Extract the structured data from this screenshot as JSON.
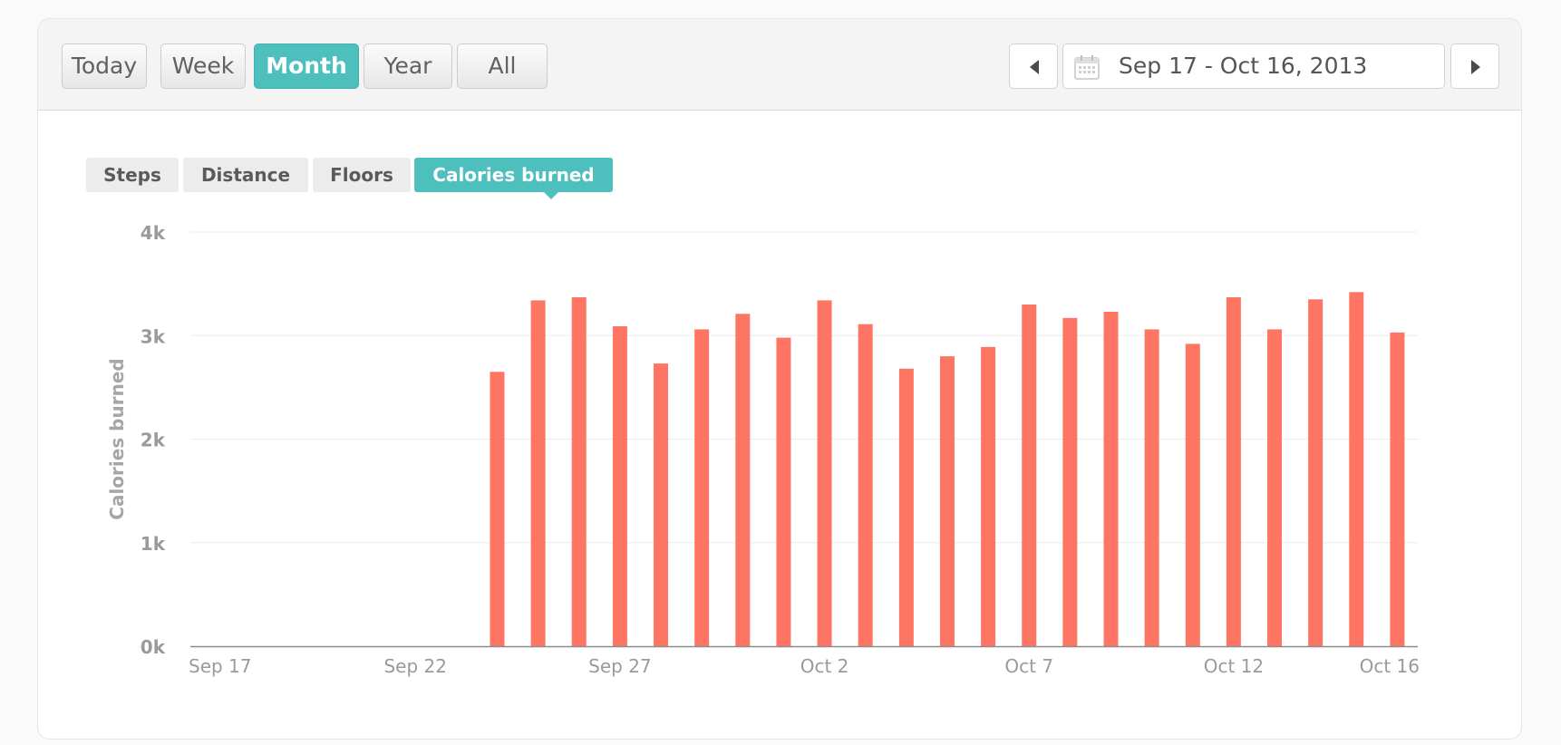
{
  "range_buttons": [
    {
      "label": "Today",
      "active": false
    },
    {
      "label": "Week",
      "active": false
    },
    {
      "label": "Month",
      "active": true
    },
    {
      "label": "Year",
      "active": false
    },
    {
      "label": "All",
      "active": false
    }
  ],
  "date_range": {
    "label": "Sep 17 - Oct 16, 2013"
  },
  "metric_tabs": [
    {
      "label": "Steps",
      "active": false
    },
    {
      "label": "Distance",
      "active": false
    },
    {
      "label": "Floors",
      "active": false
    },
    {
      "label": "Calories burned",
      "active": true
    }
  ],
  "colors": {
    "accent": "#4dbfbd",
    "bar": "#ff7563"
  },
  "chart_data": {
    "type": "bar",
    "ylabel": "Calories burned",
    "ylim": [
      0,
      4000
    ],
    "y_ticks": [
      0,
      1000,
      2000,
      3000,
      4000
    ],
    "y_tick_labels": [
      "0k",
      "1k",
      "2k",
      "3k",
      "4k"
    ],
    "x_tick_labels": [
      "Sep 17",
      "Sep 22",
      "Sep 27",
      "Oct 2",
      "Oct 7",
      "Oct 12",
      "Oct 16"
    ],
    "x_tick_dates": [
      "2013-09-17",
      "2013-09-22",
      "2013-09-27",
      "2013-10-02",
      "2013-10-07",
      "2013-10-12",
      "2013-10-16"
    ],
    "grid": true,
    "categories": [
      "2013-09-17",
      "2013-09-18",
      "2013-09-19",
      "2013-09-20",
      "2013-09-21",
      "2013-09-22",
      "2013-09-23",
      "2013-09-24",
      "2013-09-25",
      "2013-09-26",
      "2013-09-27",
      "2013-09-28",
      "2013-09-29",
      "2013-09-30",
      "2013-10-01",
      "2013-10-02",
      "2013-10-03",
      "2013-10-04",
      "2013-10-05",
      "2013-10-06",
      "2013-10-07",
      "2013-10-08",
      "2013-10-09",
      "2013-10-10",
      "2013-10-11",
      "2013-10-12",
      "2013-10-13",
      "2013-10-14",
      "2013-10-15",
      "2013-10-16"
    ],
    "values": [
      0,
      0,
      0,
      0,
      0,
      0,
      0,
      2650,
      3340,
      3370,
      3090,
      2730,
      3060,
      3210,
      2980,
      3340,
      3110,
      2680,
      2800,
      2890,
      3300,
      3170,
      3230,
      3060,
      2920,
      3370,
      3060,
      3350,
      3420,
      3030
    ]
  }
}
